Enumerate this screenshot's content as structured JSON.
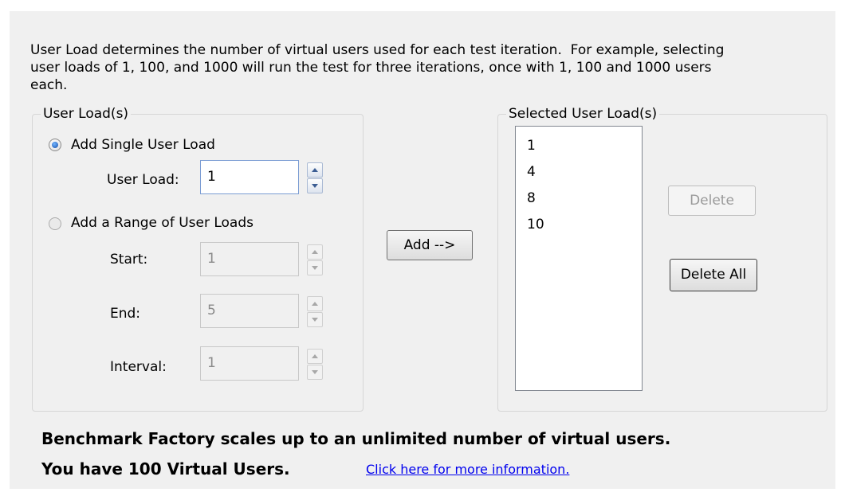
{
  "description": "User Load determines the number of virtual users used for each test iteration.  For example, selecting\nuser loads of 1, 100, and 1000 will run the test for three iterations, once with 1, 100 and 1000 users\neach.",
  "user_loads_group": {
    "legend": "User Load(s)",
    "single": {
      "label": "Add Single User Load",
      "checked": true,
      "field_label": "User Load:",
      "value": "1"
    },
    "range": {
      "label": "Add a Range of User Loads",
      "checked": false,
      "start_label": "Start:",
      "start_value": "1",
      "end_label": "End:",
      "end_value": "5",
      "interval_label": "Interval:",
      "interval_value": "1"
    }
  },
  "add_button_label": "Add -->",
  "selected_group": {
    "legend": "Selected User Load(s)",
    "items": [
      "1",
      "4",
      "8",
      "10"
    ],
    "delete_label": "Delete",
    "delete_all_label": "Delete All"
  },
  "footer": {
    "line1": "Benchmark Factory scales up to an unlimited number of virtual users.",
    "line2": "You have 100 Virtual Users.",
    "link": "Click here for more information."
  },
  "colors": {
    "panel_bg": "#f0f0f0",
    "link": "#0000ee",
    "radio_selected": "#1a4fa8"
  }
}
